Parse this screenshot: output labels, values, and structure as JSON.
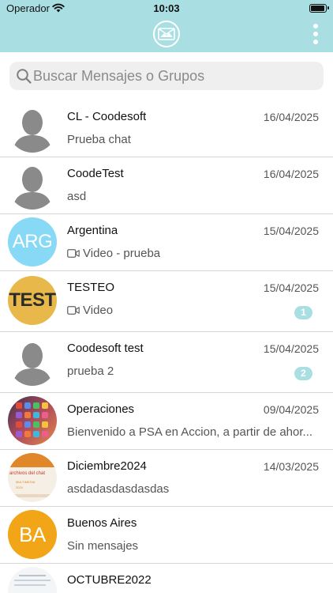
{
  "status_bar": {
    "carrier": "Operador",
    "time": "10:03",
    "wifi_icon": "wifi-icon",
    "battery_icon": "battery-icon"
  },
  "header": {
    "logo_icon": "image-mail-logo-icon",
    "menu_icon": "more-vertical-icon",
    "color": "#a9dfe3"
  },
  "search": {
    "placeholder": "Buscar Mensajes o Grupos",
    "value": "",
    "icon": "search-icon"
  },
  "chats": [
    {
      "name": "CL - Coodesoft",
      "date": "16/04/2025",
      "preview": "Prueba chat",
      "has_video_icon": false,
      "unread": "",
      "avatar": "default-person-avatar",
      "avatar_text": ""
    },
    {
      "name": "CoodeTest",
      "date": "16/04/2025",
      "preview": "asd",
      "has_video_icon": false,
      "unread": "",
      "avatar": "default-person-avatar",
      "avatar_text": ""
    },
    {
      "name": "Argentina",
      "date": "15/04/2025",
      "preview": "Video - prueba",
      "has_video_icon": true,
      "unread": "",
      "avatar": "initials",
      "avatar_text": "ARG",
      "avatar_color": "#87d9f5"
    },
    {
      "name": "TESTEO",
      "date": "15/04/2025",
      "preview": "Video",
      "has_video_icon": true,
      "unread": "1",
      "avatar": "initials",
      "avatar_text": "TEST",
      "avatar_color": "#e8b94a"
    },
    {
      "name": "Coodesoft test",
      "date": "15/04/2025",
      "preview": "prueba 2",
      "has_video_icon": false,
      "unread": "2",
      "avatar": "default-person-avatar",
      "avatar_text": ""
    },
    {
      "name": "Operaciones",
      "date": "09/04/2025",
      "preview": "Bienvenido a PSA en Accion, a partir de ahor...",
      "has_video_icon": false,
      "unread": "",
      "avatar": "photo-phone-homescreen",
      "avatar_text": ""
    },
    {
      "name": "Diciembre2024",
      "date": "14/03/2025",
      "preview": "asdadasdasdasdas",
      "has_video_icon": false,
      "unread": "",
      "avatar": "photo-screenshot",
      "avatar_text": "archivos del chat"
    },
    {
      "name": "Buenos Aires",
      "date": "",
      "preview": "Sin mensajes",
      "has_video_icon": false,
      "unread": "",
      "avatar": "initials",
      "avatar_text": "BA",
      "avatar_color": "#f2a516"
    },
    {
      "name": "OCTUBRE2022",
      "date": "",
      "preview": "",
      "has_video_icon": false,
      "unread": "",
      "avatar": "photo-document",
      "avatar_text": ""
    }
  ]
}
